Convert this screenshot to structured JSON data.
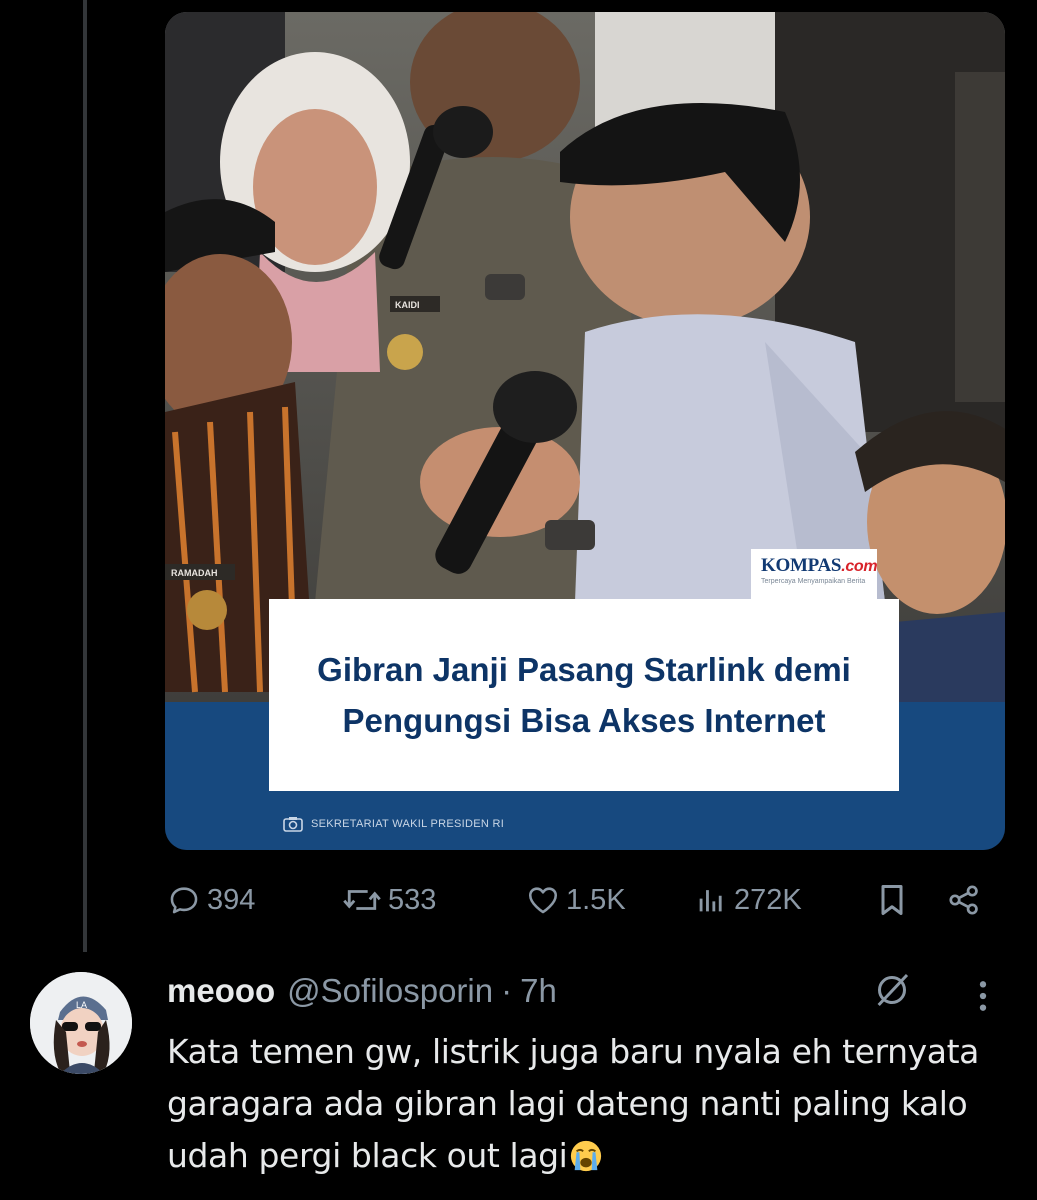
{
  "post": {
    "media": {
      "source_logo": "KOMPAS",
      "source_logo_suffix": ".com",
      "source_tagline": "Terpercaya Menyampaikan Berita",
      "name_tag_left": "RAMADAH",
      "name_tag_mid": "KAIDI",
      "headline": "Gibran Janji Pasang Starlink demi Pengungsi Bisa Akses Internet",
      "photo_credit": "SEKRETARIAT WAKIL PRESIDEN RI",
      "band_color": "#17497f"
    },
    "actions": {
      "replies": "394",
      "reposts": "533",
      "likes": "1.5K",
      "views": "272K"
    }
  },
  "reply": {
    "display_name": "meooo",
    "handle": "@Sofilosporin",
    "separator": "·",
    "time": "7h",
    "text": "Kata temen gw, listrik juga baru nyala eh ternyata garagara ada gibran lagi dateng nanti paling kalo udah pergi black out lagi",
    "emoji": "loudly-crying-face"
  },
  "colors": {
    "background": "#000000",
    "text_primary": "#e7e9ea",
    "text_secondary": "#8b98a5",
    "thread_line": "#333639"
  }
}
